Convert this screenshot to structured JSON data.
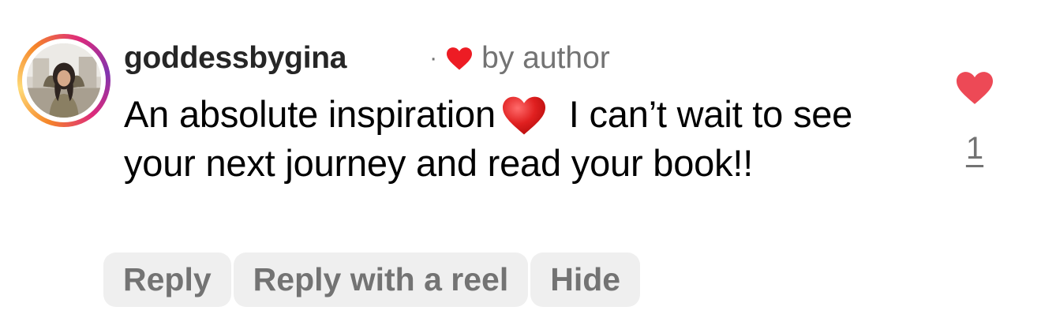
{
  "comment": {
    "username": "goddessbygina",
    "separator": "·",
    "author_badge_icon": "red-heart-icon",
    "author_badge_text": "by author",
    "text_before_emoji": "An absolute inspiration",
    "emoji_icon": "red-heart-emoji-icon",
    "text_after_emoji": " I can’t wait to see your next journey and read your book!!"
  },
  "actions": {
    "reply_label": "Reply",
    "reply_reel_label": "Reply with a reel",
    "hide_label": "Hide"
  },
  "like": {
    "icon": "heart-filled-icon",
    "count": "1",
    "color": "#ed4956"
  },
  "colors": {
    "username": "#262626",
    "secondary_text": "#737373",
    "pill_background": "#efefef",
    "heart_red": "#ed4956"
  }
}
